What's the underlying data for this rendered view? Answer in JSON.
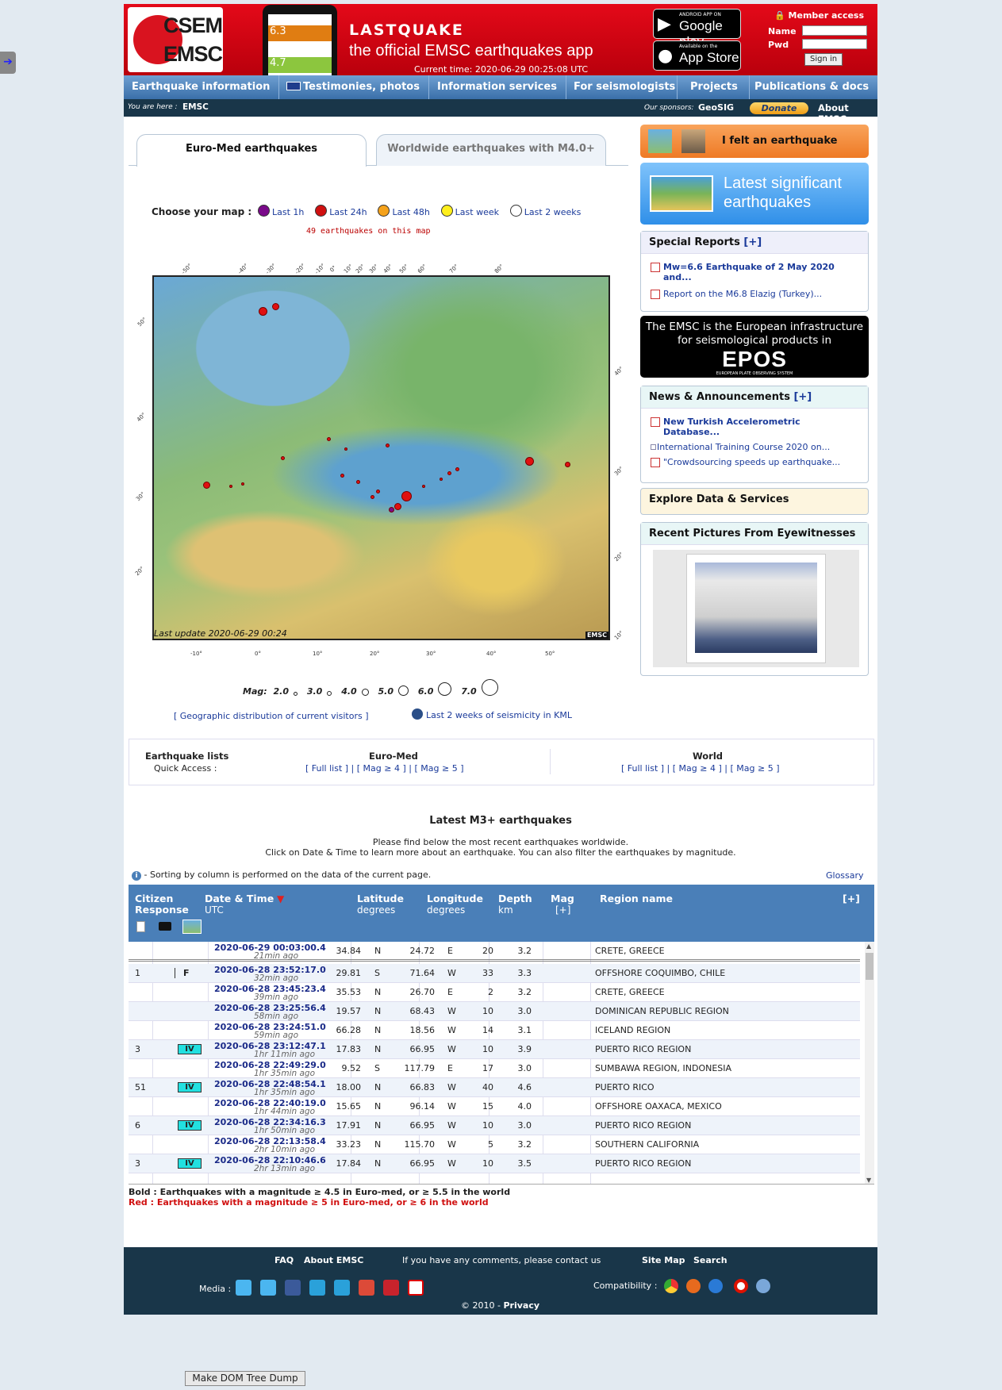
{
  "header": {
    "logo_top": "CSEM",
    "logo_bottom": "EMSC",
    "phone_val1": "6.3",
    "phone_val2": "4.7",
    "app_title": "LASTQUAKE",
    "app_subtitle": "the official EMSC earthquakes app",
    "current_time": "Current time: 2020-06-29 00:25:08 UTC",
    "google_small": "ANDROID APP ON",
    "google_big": "Google play",
    "apple_small": "Available on the",
    "apple_big": "App Store",
    "member_access": "Member access",
    "name_label": "Name",
    "pwd_label": "Pwd",
    "sign_in": "Sign in"
  },
  "nav": {
    "items": [
      "Earthquake information",
      "Testimonies, photos",
      "Information services",
      "For seismologists",
      "Projects",
      "Publications & docs"
    ]
  },
  "breadcrumb": {
    "prefix": "You are here :",
    "current": "EMSC",
    "sponsors_label": "Our sponsors:",
    "sponsor": "GeoSIG",
    "donate": "Donate",
    "about": "About EMSC"
  },
  "tabs": [
    "Euro-Med earthquakes",
    "Worldwide earthquakes with M4.0+"
  ],
  "map_choice": {
    "label": "Choose your map :",
    "options": [
      {
        "label": "Last 1h",
        "color": "#7a0a8a"
      },
      {
        "label": "Last 24h",
        "color": "#d01010"
      },
      {
        "label": "Last 48h",
        "color": "#f5a21b"
      },
      {
        "label": "Last week",
        "color": "#ffef1c"
      },
      {
        "label": "Last 2 weeks",
        "color": "#ffffff"
      }
    ],
    "count": "49 earthquakes on this map"
  },
  "map": {
    "last_update": "Last update 2020-06-29 00:24",
    "brand": "EMSC",
    "bottom_ticks": [
      "-10°",
      "0°",
      "10°",
      "20°",
      "30°",
      "40°",
      "50°"
    ],
    "top_ticks": [
      "-50°",
      "-40°",
      "-30°",
      "-20°",
      "-10°",
      "0°",
      "10°",
      "20°",
      "30°",
      "40°",
      "50°",
      "60°",
      "70°",
      "80°"
    ],
    "left_ticks": [
      "50°",
      "40°",
      "30°",
      "20°"
    ],
    "right_ticks": [
      "40°",
      "30°",
      "20°",
      "10°"
    ]
  },
  "magnitude_legend": {
    "label": "Mag:",
    "values": [
      "2.0",
      "3.0",
      "4.0",
      "5.0",
      "6.0",
      "7.0"
    ]
  },
  "links": {
    "geo": "[ Geographic distribution of current visitors ]",
    "kml": "Last 2 weeks of seismicity in KML"
  },
  "sidebar": {
    "felt": "I felt an earthquake",
    "latest": "Latest significant earthquakes",
    "special_reports_title": "Special Reports",
    "plus": "[+]",
    "special_reports": [
      "Mw=6.6 Earthquake of 2 May 2020 and...",
      "Report on the M6.8 Elazig (Turkey)..."
    ],
    "epos_line1": "The EMSC is the European infrastructure",
    "epos_line2": "for seismological products in",
    "epos_logo": "EPOS",
    "epos_sub": "EUROPEAN PLATE OBSERVING SYSTEM",
    "news_title": "News & Announcements",
    "news": [
      "New Turkish Accelerometric Database...",
      "International Training Course 2020 on...",
      "\"Crowdsourcing speeds up earthquake..."
    ],
    "explore": "Explore Data & Services",
    "pictures": "Recent Pictures From Eyewitnesses"
  },
  "quick_access": {
    "title": "Earthquake lists",
    "subtitle": "Quick Access :",
    "euromed_title": "Euro-Med",
    "world_title": "World",
    "links": [
      "[ Full list ]",
      "|",
      "[ Mag ≥ 4 ]",
      "|",
      "[ Mag ≥ 5 ]"
    ]
  },
  "latest_section": {
    "title": "Latest M3+ earthquakes",
    "intro1": "Please find below the most recent earthquakes worldwide.",
    "intro2": "Click on Date & Time to learn more about an earthquake. You can also filter the earthquakes by magnitude.",
    "sort_note": "- Sorting by column is performed on the data of the current page.",
    "glossary": "Glossary"
  },
  "table": {
    "headers": {
      "citizen": "Citizen",
      "response": "Response",
      "datetime": "Date & Time",
      "utc": "UTC",
      "latitude": "Latitude",
      "degrees": "degrees",
      "longitude": "Longitude",
      "depth": "Depth",
      "km": "km",
      "mag": "Mag",
      "plus": "[+]",
      "region": "Region name"
    },
    "rows": [
      {
        "citizen": "",
        "intensity": "",
        "felt": "",
        "date": "2020-06-29   00:03:00.4",
        "ago": "21min ago",
        "lat": "34.84",
        "ns": "N",
        "lon": "24.72",
        "ew": "E",
        "depth": "20",
        "mag": "3.2",
        "region": "CRETE, GREECE"
      },
      {
        "citizen": "1",
        "intensity": "",
        "felt": "F",
        "date": "2020-06-28   23:52:17.0",
        "ago": "32min ago",
        "lat": "29.81",
        "ns": "S",
        "lon": "71.64",
        "ew": "W",
        "depth": "33",
        "mag": "3.3",
        "region": "OFFSHORE COQUIMBO, CHILE"
      },
      {
        "citizen": "",
        "intensity": "",
        "felt": "",
        "date": "2020-06-28   23:45:23.4",
        "ago": "39min ago",
        "lat": "35.53",
        "ns": "N",
        "lon": "26.70",
        "ew": "E",
        "depth": "2",
        "mag": "3.2",
        "region": "CRETE, GREECE"
      },
      {
        "citizen": "",
        "intensity": "",
        "felt": "",
        "date": "2020-06-28   23:25:56.4",
        "ago": "58min ago",
        "lat": "19.57",
        "ns": "N",
        "lon": "68.43",
        "ew": "W",
        "depth": "10",
        "mag": "3.0",
        "region": "DOMINICAN REPUBLIC REGION"
      },
      {
        "citizen": "",
        "intensity": "",
        "felt": "",
        "date": "2020-06-28   23:24:51.0",
        "ago": "59min ago",
        "lat": "66.28",
        "ns": "N",
        "lon": "18.56",
        "ew": "W",
        "depth": "14",
        "mag": "3.1",
        "region": "ICELAND REGION"
      },
      {
        "citizen": "3",
        "intensity": "IV",
        "felt": "",
        "date": "2020-06-28   23:12:47.1",
        "ago": "1hr 11min ago",
        "lat": "17.83",
        "ns": "N",
        "lon": "66.95",
        "ew": "W",
        "depth": "10",
        "mag": "3.9",
        "region": "PUERTO RICO REGION"
      },
      {
        "citizen": "",
        "intensity": "",
        "felt": "",
        "date": "2020-06-28   22:49:29.0",
        "ago": "1hr 35min ago",
        "lat": "9.52",
        "ns": "S",
        "lon": "117.79",
        "ew": "E",
        "depth": "17",
        "mag": "3.0",
        "region": "SUMBAWA REGION, INDONESIA"
      },
      {
        "citizen": "51",
        "intensity": "IV",
        "felt": "",
        "date": "2020-06-28   22:48:54.1",
        "ago": "1hr 35min ago",
        "lat": "18.00",
        "ns": "N",
        "lon": "66.83",
        "ew": "W",
        "depth": "40",
        "mag": "4.6",
        "region": "PUERTO RICO"
      },
      {
        "citizen": "",
        "intensity": "",
        "felt": "",
        "date": "2020-06-28   22:40:19.0",
        "ago": "1hr 44min ago",
        "lat": "15.65",
        "ns": "N",
        "lon": "96.14",
        "ew": "W",
        "depth": "15",
        "mag": "4.0",
        "region": "OFFSHORE OAXACA, MEXICO"
      },
      {
        "citizen": "6",
        "intensity": "IV",
        "felt": "",
        "date": "2020-06-28   22:34:16.3",
        "ago": "1hr 50min ago",
        "lat": "17.91",
        "ns": "N",
        "lon": "66.95",
        "ew": "W",
        "depth": "10",
        "mag": "3.0",
        "region": "PUERTO RICO REGION"
      },
      {
        "citizen": "",
        "intensity": "",
        "felt": "",
        "date": "2020-06-28   22:13:58.4",
        "ago": "2hr 10min ago",
        "lat": "33.23",
        "ns": "N",
        "lon": "115.70",
        "ew": "W",
        "depth": "5",
        "mag": "3.2",
        "region": "SOUTHERN CALIFORNIA"
      },
      {
        "citizen": "3",
        "intensity": "IV",
        "felt": "",
        "date": "2020-06-28   22:10:46.6",
        "ago": "2hr 13min ago",
        "lat": "17.84",
        "ns": "N",
        "lon": "66.95",
        "ew": "W",
        "depth": "10",
        "mag": "3.5",
        "region": "PUERTO RICO REGION"
      }
    ]
  },
  "legend": {
    "bold": "Bold : Earthquakes with a magnitude ≥ 4.5 in Euro-med, or ≥ 5.5 in the world",
    "red": "Red : Earthquakes with a magnitude ≥ 5 in Euro-med, or ≥ 6 in the world"
  },
  "footer": {
    "faq": "FAQ",
    "about": "About EMSC",
    "contact": "If you have any comments, please contact us",
    "sitemap": "Site Map",
    "search": "Search",
    "media": "Media :",
    "compat": "Compatibility :",
    "copyright": "© 2010 -",
    "privacy": "Privacy"
  },
  "dom_button": "Make DOM Tree Dump"
}
